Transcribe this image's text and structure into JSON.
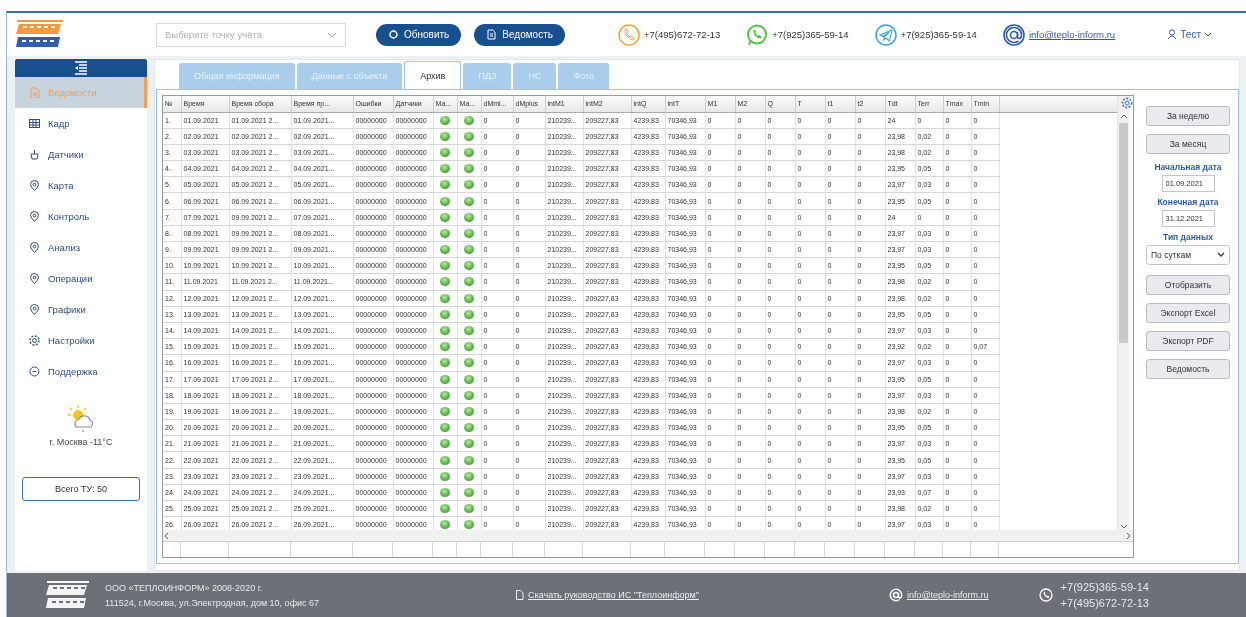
{
  "header": {
    "point_select": {
      "placeholder": "Выберите точку учёта"
    },
    "buttons": [
      {
        "label": "Обновить"
      },
      {
        "label": "Ведомость"
      }
    ],
    "contacts": [
      {
        "text": "+7(495)672-72-13",
        "kind": "phone"
      },
      {
        "text": "+7(925)365-59-14",
        "kind": "phone"
      },
      {
        "text": "+7(925)365-59-14",
        "kind": "phone"
      },
      {
        "text": "info@teplo-inform.ru",
        "kind": "email"
      }
    ],
    "user": {
      "name": "Тест"
    }
  },
  "sidebar": {
    "items": [
      {
        "label": "Ведомости",
        "selected": true
      },
      {
        "label": "Кадр",
        "selected": false
      },
      {
        "label": "Датчики",
        "selected": false
      },
      {
        "label": "Карта",
        "selected": false
      },
      {
        "label": "Контроль",
        "selected": false
      },
      {
        "label": "Анализ",
        "selected": false
      },
      {
        "label": "Операции",
        "selected": false
      },
      {
        "label": "Графики",
        "selected": false
      },
      {
        "label": "Настройки",
        "selected": false
      },
      {
        "label": "Поддержка",
        "selected": false
      }
    ],
    "weather": "г. Москва -11°C",
    "total_button": "Всего ТУ: 50"
  },
  "tabs": [
    {
      "label": "Общая информация",
      "selected": false
    },
    {
      "label": "Данные с объекта",
      "selected": false
    },
    {
      "label": "Архив",
      "selected": true
    },
    {
      "label": "ПДЗ",
      "selected": false
    },
    {
      "label": "НС",
      "selected": false
    },
    {
      "label": "Фото",
      "selected": false
    }
  ],
  "table": {
    "columns": [
      {
        "label": "№",
        "kind": "text"
      },
      {
        "label": "Время",
        "kind": "text"
      },
      {
        "label": "Время сбора",
        "kind": "text"
      },
      {
        "label": "Время пр...",
        "kind": "text"
      },
      {
        "label": "Ошибки",
        "kind": "text"
      },
      {
        "label": "Датчики",
        "kind": "text"
      },
      {
        "label": "Ма...",
        "kind": "lamp"
      },
      {
        "label": "Ма...",
        "kind": "lamp"
      },
      {
        "label": "dMmi...",
        "kind": "text"
      },
      {
        "label": "dMplus",
        "kind": "text"
      },
      {
        "label": "intM1",
        "kind": "text"
      },
      {
        "label": "intM2",
        "kind": "text"
      },
      {
        "label": "intQ",
        "kind": "text"
      },
      {
        "label": "intT",
        "kind": "text"
      },
      {
        "label": "M1",
        "kind": "text"
      },
      {
        "label": "M2",
        "kind": "text"
      },
      {
        "label": "Q",
        "kind": "text"
      },
      {
        "label": "T",
        "kind": "text"
      },
      {
        "label": "t1",
        "kind": "text"
      },
      {
        "label": "t2",
        "kind": "text"
      },
      {
        "label": "Tdt",
        "kind": "text"
      },
      {
        "label": "Terr",
        "kind": "text"
      },
      {
        "label": "Tmax",
        "kind": "text"
      },
      {
        "label": "Tmin",
        "kind": "text"
      }
    ],
    "rows": [
      {
        "cells": [
          "1.",
          "01.09.2021",
          "01.09.2021 2...",
          "01.09.2021...",
          "00000000",
          "00000000",
          "",
          "",
          "0",
          "0",
          "210239...",
          "209227,83",
          "4239,83",
          "70346,93",
          "0",
          "0",
          "0",
          "0",
          "0",
          "0",
          "24",
          "0",
          "0",
          "0"
        ],
        "lamps": [
          true,
          true
        ]
      },
      {
        "cells": [
          "2.",
          "02.09.2021",
          "02.09.2021 2...",
          "02.09.2021...",
          "00000000",
          "00000000",
          "",
          "",
          "0",
          "0",
          "210239...",
          "209227,83",
          "4239,83",
          "70346,93",
          "0",
          "0",
          "0",
          "0",
          "0",
          "0",
          "23,98",
          "0,02",
          "0",
          "0"
        ],
        "lamps": [
          true,
          true
        ]
      },
      {
        "cells": [
          "3.",
          "03.09.2021",
          "03.09.2021 2...",
          "03.09.2021...",
          "00000000",
          "00000000",
          "",
          "",
          "0",
          "0",
          "210239...",
          "209227,83",
          "4239,83",
          "70346,93",
          "0",
          "0",
          "0",
          "0",
          "0",
          "0",
          "23,98",
          "0,02",
          "0",
          "0"
        ],
        "lamps": [
          true,
          true
        ]
      },
      {
        "cells": [
          "4.",
          "04.09.2021",
          "04.09.2021 2...",
          "04.09.2021...",
          "00000000",
          "00000000",
          "",
          "",
          "0",
          "0",
          "210239...",
          "209227,83",
          "4239,83",
          "70346,93",
          "0",
          "0",
          "0",
          "0",
          "0",
          "0",
          "23,95",
          "0,05",
          "0",
          "0"
        ],
        "lamps": [
          true,
          true
        ]
      },
      {
        "cells": [
          "5.",
          "05.09.2021",
          "05.09.2021 2...",
          "05.09.2021...",
          "00000000",
          "00000000",
          "",
          "",
          "0",
          "0",
          "210239...",
          "209227,83",
          "4239,83",
          "70346,93",
          "0",
          "0",
          "0",
          "0",
          "0",
          "0",
          "23,97",
          "0,03",
          "0",
          "0"
        ],
        "lamps": [
          true,
          true
        ]
      },
      {
        "cells": [
          "6.",
          "06.09.2021",
          "06.09.2021 2...",
          "06.09.2021...",
          "00000000",
          "00000000",
          "",
          "",
          "0",
          "0",
          "210239...",
          "209227,83",
          "4239,83",
          "70346,93",
          "0",
          "0",
          "0",
          "0",
          "0",
          "0",
          "23,95",
          "0,05",
          "0",
          "0"
        ],
        "lamps": [
          true,
          true
        ]
      },
      {
        "cells": [
          "7.",
          "07.09.2021",
          "09.09.2021 2...",
          "07.09.2021...",
          "00000000",
          "00000000",
          "",
          "",
          "0",
          "0",
          "210239...",
          "209227,83",
          "4239,83",
          "70346,93",
          "0",
          "0",
          "0",
          "0",
          "0",
          "0",
          "24",
          "0",
          "0",
          "0"
        ],
        "lamps": [
          true,
          true
        ]
      },
      {
        "cells": [
          "8.",
          "08.09.2021",
          "09.09.2021 2...",
          "08.09.2021...",
          "00000000",
          "00000000",
          "",
          "",
          "0",
          "0",
          "210239...",
          "209227,83",
          "4239,83",
          "70346,93",
          "0",
          "0",
          "0",
          "0",
          "0",
          "0",
          "23,97",
          "0,03",
          "0",
          "0"
        ],
        "lamps": [
          true,
          true
        ]
      },
      {
        "cells": [
          "9.",
          "09.09.2021",
          "09.09.2021 2...",
          "09.09.2021...",
          "00000000",
          "00000000",
          "",
          "",
          "0",
          "0",
          "210239...",
          "209227,83",
          "4239,83",
          "70346,93",
          "0",
          "0",
          "0",
          "0",
          "0",
          "0",
          "23,97",
          "0,03",
          "0",
          "0"
        ],
        "lamps": [
          true,
          true
        ]
      },
      {
        "cells": [
          "10.",
          "10.09.2021",
          "10.09.2021 2...",
          "10.09.2021...",
          "00000000",
          "00000000",
          "",
          "",
          "0",
          "0",
          "210239...",
          "209227,83",
          "4239,83",
          "70346,93",
          "0",
          "0",
          "0",
          "0",
          "0",
          "0",
          "23,95",
          "0,05",
          "0",
          "0"
        ],
        "lamps": [
          true,
          true
        ]
      },
      {
        "cells": [
          "11.",
          "11.09.2021",
          "11.09.2021 2...",
          "11.09.2021...",
          "00000000",
          "00000000",
          "",
          "",
          "0",
          "0",
          "210239...",
          "209227,83",
          "4239,83",
          "70346,93",
          "0",
          "0",
          "0",
          "0",
          "0",
          "0",
          "23,98",
          "0,02",
          "0",
          "0"
        ],
        "lamps": [
          true,
          true
        ]
      },
      {
        "cells": [
          "12.",
          "12.09.2021",
          "12.09.2021 2...",
          "12.09.2021...",
          "00000000",
          "00000000",
          "",
          "",
          "0",
          "0",
          "210239...",
          "209227,83",
          "4239,83",
          "70346,93",
          "0",
          "0",
          "0",
          "0",
          "0",
          "0",
          "23,98",
          "0,02",
          "0",
          "0"
        ],
        "lamps": [
          true,
          true
        ]
      },
      {
        "cells": [
          "13.",
          "13.09.2021",
          "13.09.2021 2...",
          "13.09.2021...",
          "00000000",
          "00000000",
          "",
          "",
          "0",
          "0",
          "210239...",
          "209227,83",
          "4239,83",
          "70346,93",
          "0",
          "0",
          "0",
          "0",
          "0",
          "0",
          "23,95",
          "0,05",
          "0",
          "0"
        ],
        "lamps": [
          true,
          true
        ]
      },
      {
        "cells": [
          "14.",
          "14.09.2021",
          "14.09.2021 2...",
          "14.09.2021...",
          "00000000",
          "00000000",
          "",
          "",
          "0",
          "0",
          "210239...",
          "209227,83",
          "4239,83",
          "70346,93",
          "0",
          "0",
          "0",
          "0",
          "0",
          "0",
          "23,97",
          "0,03",
          "0",
          "0"
        ],
        "lamps": [
          true,
          true
        ]
      },
      {
        "cells": [
          "15.",
          "15.09.2021",
          "15.09.2021 2...",
          "15.09.2021...",
          "00000000",
          "00000000",
          "",
          "",
          "0",
          "0",
          "210239...",
          "209227,83",
          "4239,83",
          "70346,93",
          "0",
          "0",
          "0",
          "0",
          "0",
          "0",
          "23,92",
          "0,02",
          "0",
          "0,07"
        ],
        "lamps": [
          true,
          true
        ]
      },
      {
        "cells": [
          "16.",
          "16.09.2021",
          "16.09.2021 2...",
          "16.09.2021...",
          "00000000",
          "00000000",
          "",
          "",
          "0",
          "0",
          "210239...",
          "209227,83",
          "4239,83",
          "70346,93",
          "0",
          "0",
          "0",
          "0",
          "0",
          "0",
          "23,97",
          "0,03",
          "0",
          "0"
        ],
        "lamps": [
          true,
          true
        ]
      },
      {
        "cells": [
          "17.",
          "17.09.2021",
          "17.09.2021 2...",
          "17.09.2021...",
          "00000000",
          "00000000",
          "",
          "",
          "0",
          "0",
          "210239...",
          "209227,83",
          "4239,83",
          "70346,93",
          "0",
          "0",
          "0",
          "0",
          "0",
          "0",
          "23,95",
          "0,05",
          "0",
          "0"
        ],
        "lamps": [
          true,
          true
        ]
      },
      {
        "cells": [
          "18.",
          "18.09.2021",
          "18.09.2021 2...",
          "18.09.2021...",
          "00000000",
          "00000000",
          "",
          "",
          "0",
          "0",
          "210239...",
          "209227,83",
          "4239,83",
          "70346,93",
          "0",
          "0",
          "0",
          "0",
          "0",
          "0",
          "23,97",
          "0,03",
          "0",
          "0"
        ],
        "lamps": [
          true,
          true
        ]
      },
      {
        "cells": [
          "19.",
          "19.09.2021",
          "19.09.2021 2...",
          "19.09.2021...",
          "00000000",
          "00000000",
          "",
          "",
          "0",
          "0",
          "210239...",
          "209227,83",
          "4239,83",
          "70346,93",
          "0",
          "0",
          "0",
          "0",
          "0",
          "0",
          "23,98",
          "0,02",
          "0",
          "0"
        ],
        "lamps": [
          true,
          true
        ]
      },
      {
        "cells": [
          "20.",
          "20.09.2021",
          "20.09.2021 2...",
          "20.09.2021...",
          "00000000",
          "00000000",
          "",
          "",
          "0",
          "0",
          "210239...",
          "209227,83",
          "4239,83",
          "70346,93",
          "0",
          "0",
          "0",
          "0",
          "0",
          "0",
          "23,95",
          "0,05",
          "0",
          "0"
        ],
        "lamps": [
          true,
          true
        ]
      },
      {
        "cells": [
          "21.",
          "21.09.2021",
          "21.09.2021 2...",
          "21.09.2021...",
          "00000000",
          "00000000",
          "",
          "",
          "0",
          "0",
          "210239...",
          "209227,83",
          "4239,83",
          "70346,93",
          "0",
          "0",
          "0",
          "0",
          "0",
          "0",
          "23,97",
          "0,03",
          "0",
          "0"
        ],
        "lamps": [
          true,
          true
        ]
      },
      {
        "cells": [
          "22.",
          "22.09.2021",
          "22.09.2021 2...",
          "22.09.2021...",
          "00000000",
          "00000000",
          "",
          "",
          "0",
          "0",
          "210239...",
          "209227,83",
          "4239,83",
          "70346,93",
          "0",
          "0",
          "0",
          "0",
          "0",
          "0",
          "23,95",
          "0,05",
          "0",
          "0"
        ],
        "lamps": [
          true,
          true
        ]
      },
      {
        "cells": [
          "23.",
          "23.09.2021",
          "23.09.2021 2...",
          "23.09.2021...",
          "00000000",
          "00000000",
          "",
          "",
          "0",
          "0",
          "210239...",
          "209227,83",
          "4239,83",
          "70346,93",
          "0",
          "0",
          "0",
          "0",
          "0",
          "0",
          "23,97",
          "0,03",
          "0",
          "0"
        ],
        "lamps": [
          true,
          true
        ]
      },
      {
        "cells": [
          "24.",
          "24.09.2021",
          "24.09.2021 2...",
          "24.09.2021...",
          "00000000",
          "00000000",
          "",
          "",
          "0",
          "0",
          "210239...",
          "209227,83",
          "4239,83",
          "70346,93",
          "0",
          "0",
          "0",
          "0",
          "0",
          "0",
          "23,93",
          "0,07",
          "0",
          "0"
        ],
        "lamps": [
          true,
          true
        ]
      },
      {
        "cells": [
          "25.",
          "25.09.2021",
          "25.09.2021 2...",
          "25.09.2021...",
          "00000000",
          "00000000",
          "",
          "",
          "0",
          "0",
          "210239...",
          "209227,83",
          "4239,83",
          "70346,93",
          "0",
          "0",
          "0",
          "0",
          "0",
          "0",
          "23,98",
          "0,02",
          "0",
          "0"
        ],
        "lamps": [
          true,
          true
        ]
      },
      {
        "cells": [
          "26.",
          "26.09.2021",
          "26.09.2021 2...",
          "26.09.2021...",
          "00000000",
          "00000000",
          "",
          "",
          "0",
          "0",
          "210239...",
          "209227,83",
          "4239,83",
          "70346,93",
          "0",
          "0",
          "0",
          "0",
          "0",
          "0",
          "23,97",
          "0,03",
          "0",
          "0"
        ],
        "lamps": [
          true,
          true
        ]
      }
    ]
  },
  "side_panel": [
    {
      "kind": "button",
      "text": "За неделю"
    },
    {
      "kind": "button",
      "text": "За месяц"
    },
    {
      "kind": "label",
      "text": "Начальная дата"
    },
    {
      "kind": "date",
      "text": "01.09.2021"
    },
    {
      "kind": "label",
      "text": "Конечная дата"
    },
    {
      "kind": "date",
      "text": "31.12.2021"
    },
    {
      "kind": "label",
      "text": "Тип данных"
    },
    {
      "kind": "select",
      "text": "По суткам"
    },
    {
      "kind": "button",
      "text": "Отобразить"
    },
    {
      "kind": "button",
      "text": "Экспорт Excel"
    },
    {
      "kind": "button",
      "text": "Экспорт PDF"
    },
    {
      "kind": "button",
      "text": "Ведомость"
    }
  ],
  "footer": {
    "company": "ООО «ТЕПЛОИНФОРМ» 2008-2020 г.",
    "address": "111524, г.Москва, ул.Электродная, дом 10, офис 67",
    "manual_link": "Скачать руководство ИС \"Теплоинформ\"",
    "email": "info@teplo-inform.ru",
    "phones": [
      "+7(925)365-59-14",
      "+7(495)672-72-13"
    ]
  }
}
